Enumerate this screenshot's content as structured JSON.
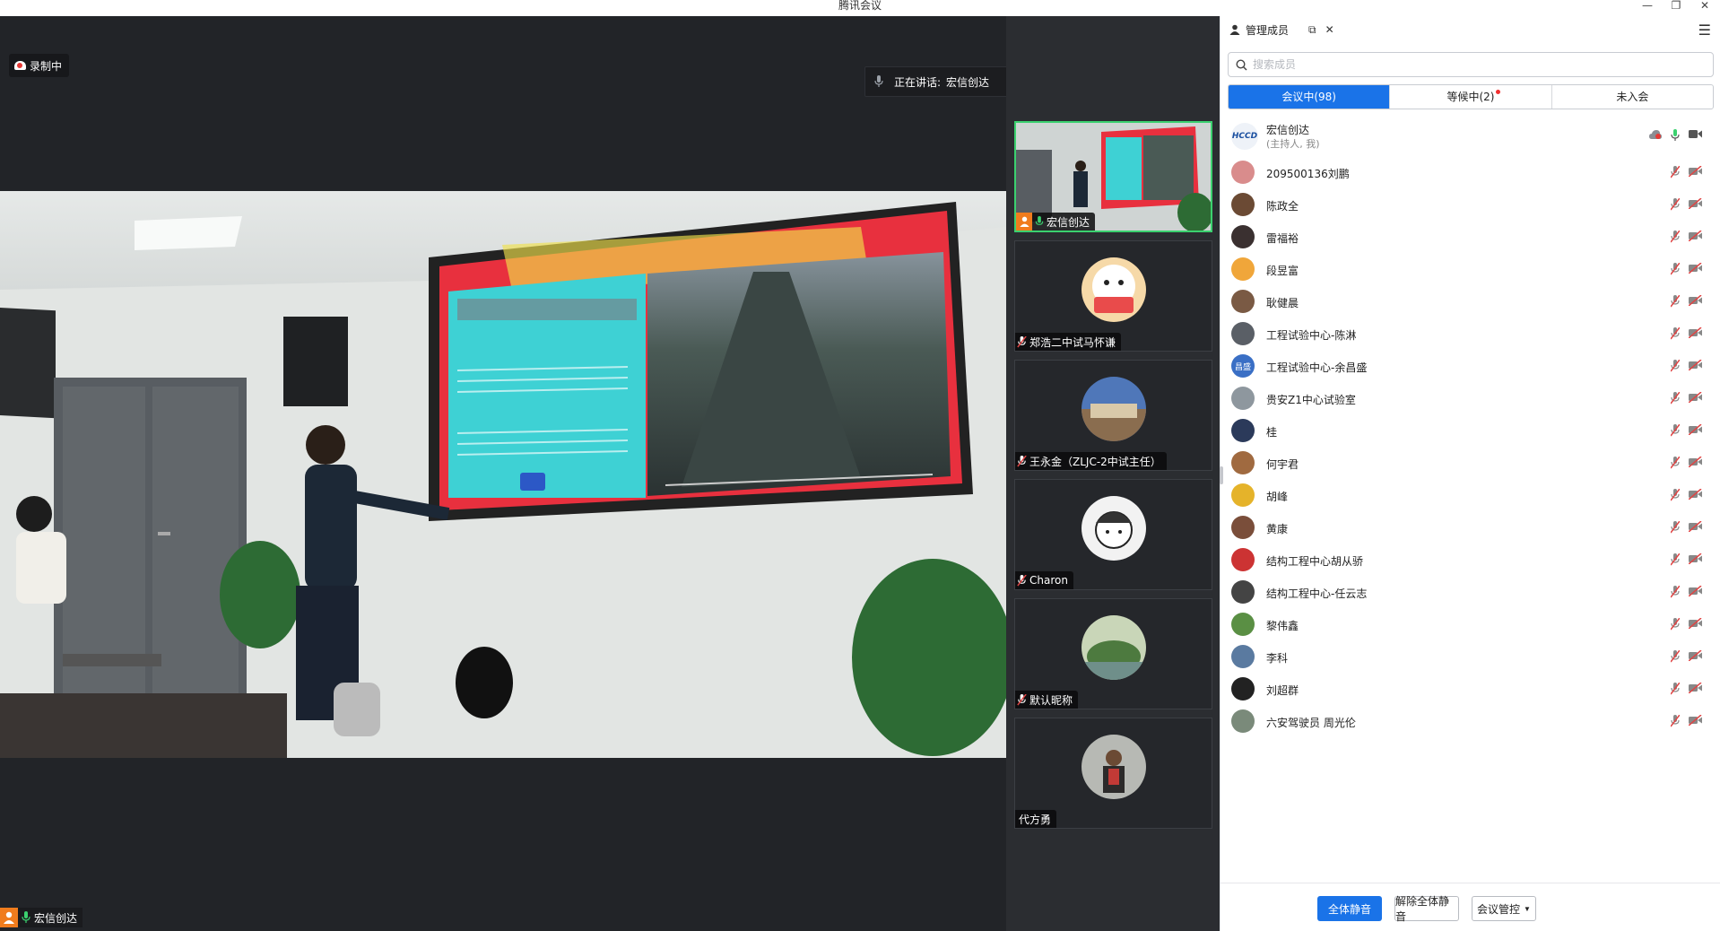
{
  "window": {
    "title": "腾讯会议",
    "minimize_icon": "minimize-icon",
    "restore_icon": "restore-icon",
    "close_icon": "close-icon"
  },
  "stage": {
    "recording_label": "录制中",
    "speaking_prefix": "正在讲话:",
    "speaking_name": "宏信创达",
    "main_speaker_name": "宏信创达"
  },
  "thumbnails": [
    {
      "name": "宏信创达",
      "active": true,
      "muted": false,
      "host": true
    },
    {
      "name": "郑浩二中试马怀谦",
      "active": false,
      "muted": true
    },
    {
      "name": "王永金（ZLJC-2中试主任）",
      "active": false,
      "muted": true
    },
    {
      "name": "Charon",
      "active": false,
      "muted": true
    },
    {
      "name": "默认昵称",
      "active": false,
      "muted": true
    },
    {
      "name": "代方勇",
      "active": false,
      "muted": false
    }
  ],
  "panel": {
    "title": "管理成员",
    "search_placeholder": "搜索成员",
    "tabs": [
      {
        "label": "会议中(98)",
        "active": true,
        "dot": false
      },
      {
        "label": "等候中(2)",
        "active": false,
        "dot": true
      },
      {
        "label": "未入会",
        "active": false,
        "dot": false
      }
    ],
    "host": {
      "name": "宏信创达",
      "role": "(主持人, 我)",
      "avatar_text": "HCCD"
    },
    "members": [
      "209500136刘鹏",
      "陈政全",
      "雷福裕",
      "段昱富",
      "耿健晨",
      "工程试验中心-陈淋",
      "工程试验中心-余昌盛",
      "贵安Z1中心试验室",
      "桂",
      "何宇君",
      "胡峰",
      "黄康",
      "结构工程中心胡从骄",
      "结构工程中心-任云志",
      "黎伟鑫",
      "李科",
      "刘超群",
      "六安驾驶员 周光伦"
    ],
    "member_avatar_text": {
      "工程试验中心-余昌盛": "昌盛"
    },
    "buttons": {
      "mute_all": "全体静音",
      "unmute_all": "解除全体静音",
      "control": "会议管控"
    }
  },
  "colors": {
    "accent": "#1a73e8",
    "active_border": "#3bd16f",
    "mic_muted": "#e04545",
    "host_badge": "#f07c1d"
  }
}
